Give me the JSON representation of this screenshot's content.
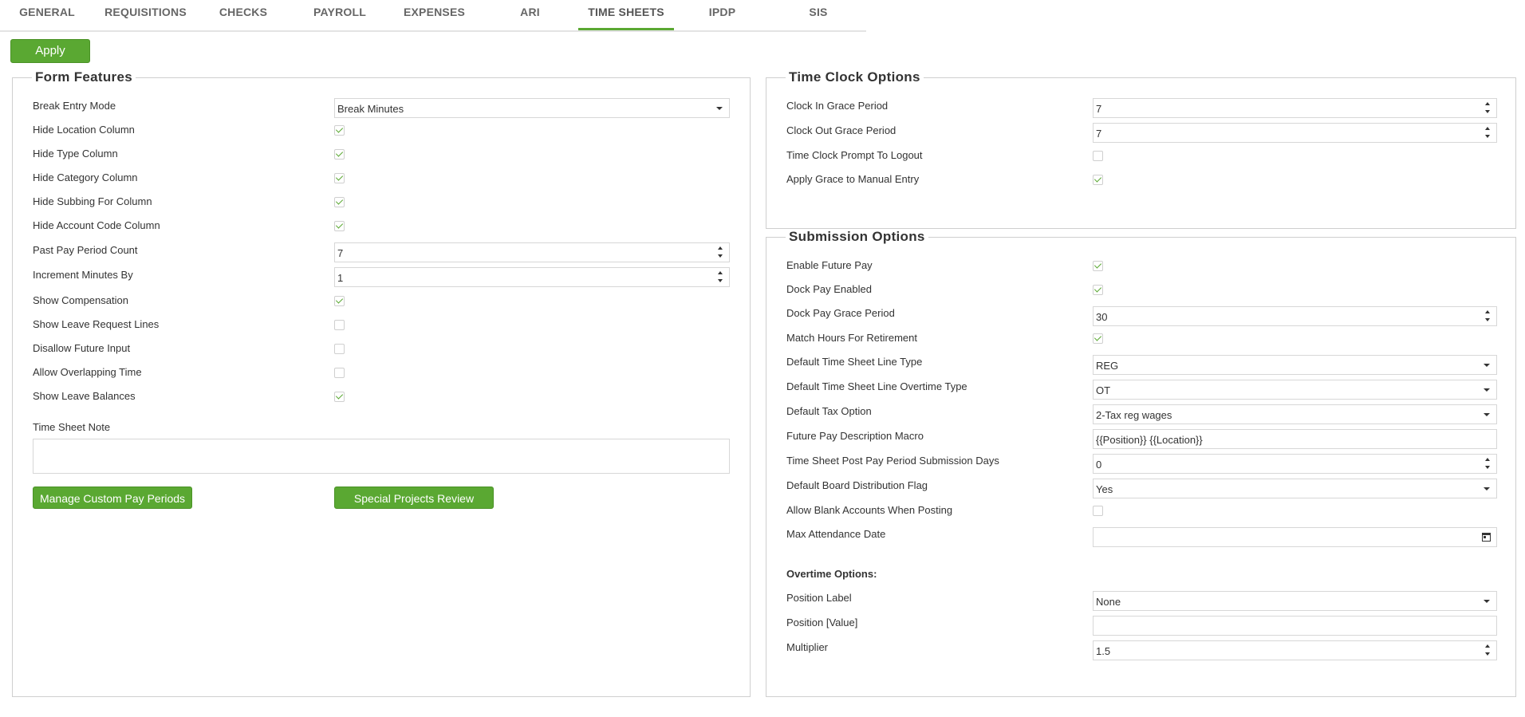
{
  "tabs": [
    "GENERAL",
    "REQUISITIONS",
    "CHECKS",
    "PAYROLL",
    "EXPENSES",
    "ARI",
    "TIME SHEETS",
    "IPDP",
    "SIS"
  ],
  "active_tab": "TIME SHEETS",
  "apply_label": "Apply",
  "form_features": {
    "title": "Form Features",
    "break_entry_mode": {
      "label": "Break Entry Mode",
      "value": "Break Minutes"
    },
    "hide_location": {
      "label": "Hide Location Column",
      "checked": true
    },
    "hide_type": {
      "label": "Hide Type Column",
      "checked": true
    },
    "hide_category": {
      "label": "Hide Category Column",
      "checked": true
    },
    "hide_subbing": {
      "label": "Hide Subbing For Column",
      "checked": true
    },
    "hide_account_code": {
      "label": "Hide Account Code Column",
      "checked": true
    },
    "past_pay_period_count": {
      "label": "Past Pay Period Count",
      "value": "7"
    },
    "increment_minutes": {
      "label": "Increment Minutes By",
      "value": "1"
    },
    "show_compensation": {
      "label": "Show Compensation",
      "checked": true
    },
    "show_leave_request_lines": {
      "label": "Show Leave Request Lines",
      "checked": false
    },
    "disallow_future_input": {
      "label": "Disallow Future Input",
      "checked": false
    },
    "allow_overlapping_time": {
      "label": "Allow Overlapping Time",
      "checked": false
    },
    "show_leave_balances": {
      "label": "Show Leave Balances",
      "checked": true
    },
    "time_sheet_note": {
      "label": "Time Sheet Note",
      "value": ""
    },
    "manage_custom_pay_periods": "Manage Custom Pay Periods",
    "special_projects_review": "Special Projects Review"
  },
  "time_clock": {
    "title": "Time Clock Options",
    "clock_in_grace": {
      "label": "Clock In Grace Period",
      "value": "7"
    },
    "clock_out_grace": {
      "label": "Clock Out Grace Period",
      "value": "7"
    },
    "prompt_to_logout": {
      "label": "Time Clock Prompt To Logout",
      "checked": false
    },
    "apply_grace_manual": {
      "label": "Apply Grace to Manual Entry",
      "checked": true
    }
  },
  "submission": {
    "title": "Submission Options",
    "enable_future_pay": {
      "label": "Enable Future Pay",
      "checked": true
    },
    "dock_pay_enabled": {
      "label": "Dock Pay Enabled",
      "checked": true
    },
    "dock_pay_grace": {
      "label": "Dock Pay Grace Period",
      "value": "30"
    },
    "match_hours_retirement": {
      "label": "Match Hours For Retirement",
      "checked": true
    },
    "default_line_type": {
      "label": "Default Time Sheet Line Type",
      "value": "REG"
    },
    "default_overtime_type": {
      "label": "Default Time Sheet Line Overtime Type",
      "value": "OT"
    },
    "default_tax_option": {
      "label": "Default Tax Option",
      "value": "2-Tax reg wages"
    },
    "future_pay_macro": {
      "label": "Future Pay Description Macro",
      "value": "{{Position}} {{Location}}"
    },
    "post_period_days": {
      "label": "Time Sheet Post Pay Period Submission Days",
      "value": "0"
    },
    "board_distribution": {
      "label": "Default Board Distribution Flag",
      "value": "Yes"
    },
    "allow_blank_accounts": {
      "label": "Allow Blank Accounts When Posting",
      "checked": false
    },
    "max_attendance_date": {
      "label": "Max Attendance Date",
      "value": ""
    },
    "overtime_header": "Overtime Options:",
    "position_label": {
      "label": "Position Label",
      "value": "None"
    },
    "position_value": {
      "label": "Position [Value]",
      "value": ""
    },
    "multiplier": {
      "label": "Multiplier",
      "value": "1.5"
    }
  },
  "colors": {
    "accent": "#5aa832",
    "border": "#cfcfcf"
  },
  "icons": {
    "checkmark": "check-icon",
    "dropdown": "chevron-down-icon",
    "spinner": "spinner-icon",
    "calendar": "calendar-icon"
  }
}
